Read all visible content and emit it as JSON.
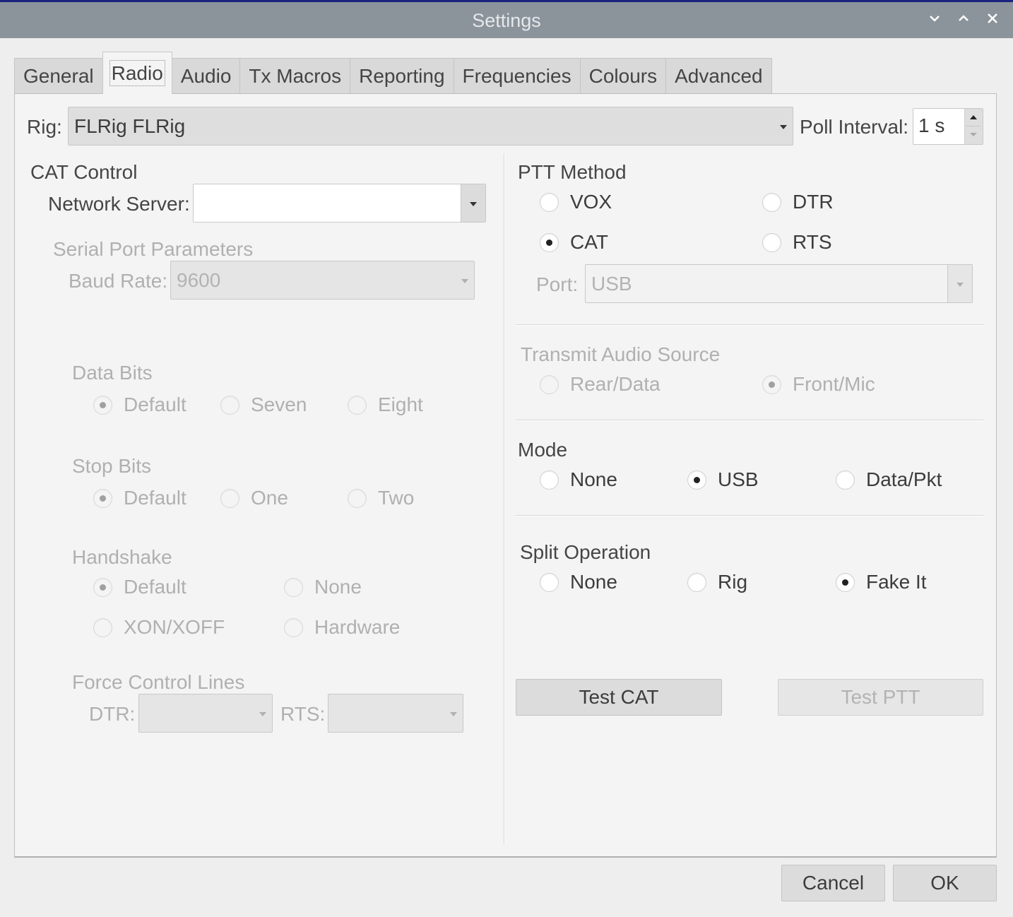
{
  "titlebar": {
    "title": "Settings",
    "minimize_icon": "chevron-down",
    "maximize_icon": "chevron-up",
    "close_icon": "x"
  },
  "tabs": [
    {
      "label": "General",
      "mnemonic": "l",
      "active": false
    },
    {
      "label": "Radio",
      "mnemonic": "R",
      "active": true
    },
    {
      "label": "Audio",
      "mnemonic": "u",
      "active": false
    },
    {
      "label": "Tx Macros",
      "mnemonic": "M",
      "active": false
    },
    {
      "label": "Reporting",
      "mnemonic": "g",
      "active": false
    },
    {
      "label": "Frequencies",
      "mnemonic": "",
      "active": false
    },
    {
      "label": "Colours",
      "mnemonic": "",
      "active": false
    },
    {
      "label": "Advanced",
      "mnemonic": "",
      "active": false
    }
  ],
  "rig": {
    "label": "Rig:",
    "value": "FLRig FLRig",
    "poll_label": "Poll Interval:",
    "poll_value": "1 s"
  },
  "cat_control": {
    "heading": "CAT Control",
    "network_server_label": "Network Server:",
    "network_server_value": "",
    "serial_heading": "Serial Port Parameters",
    "baud_label": "Baud Rate:",
    "baud_value": "9600",
    "data_bits": {
      "heading": "Data Bits",
      "options": [
        "Default",
        "Seven",
        "Eight"
      ],
      "selected": "Default"
    },
    "stop_bits": {
      "heading": "Stop Bits",
      "options": [
        "Default",
        "One",
        "Two"
      ],
      "selected": "Default"
    },
    "handshake": {
      "heading": "Handshake",
      "options": [
        "Default",
        "None",
        "XON/XOFF",
        "Hardware"
      ],
      "selected": "Default"
    },
    "force_control": {
      "heading": "Force Control Lines",
      "dtr_label": "DTR:",
      "dtr_value": "",
      "rts_label": "RTS:",
      "rts_value": ""
    }
  },
  "ptt": {
    "heading": "PTT Method",
    "options": [
      "VOX",
      "DTR",
      "CAT",
      "RTS"
    ],
    "selected": "CAT",
    "port_label": "Port:",
    "port_value": "USB"
  },
  "tx_audio": {
    "heading": "Transmit Audio Source",
    "options": [
      "Rear/Data",
      "Front/Mic"
    ],
    "selected": "Front/Mic"
  },
  "mode": {
    "heading": "Mode",
    "options": [
      "None",
      "USB",
      "Data/Pkt"
    ],
    "selected": "USB"
  },
  "split": {
    "heading": "Split Operation",
    "options": [
      "None",
      "Rig",
      "Fake It"
    ],
    "selected": "Fake It"
  },
  "buttons": {
    "test_cat": "Test CAT",
    "test_ptt": "Test PTT",
    "cancel": "Cancel",
    "ok": "OK"
  },
  "colors": {
    "titlebar_bg": "#8b939b",
    "panel_bg": "#f4f4f4",
    "window_bg": "#eeeeee",
    "disabled_text": "#b0b0b0"
  }
}
